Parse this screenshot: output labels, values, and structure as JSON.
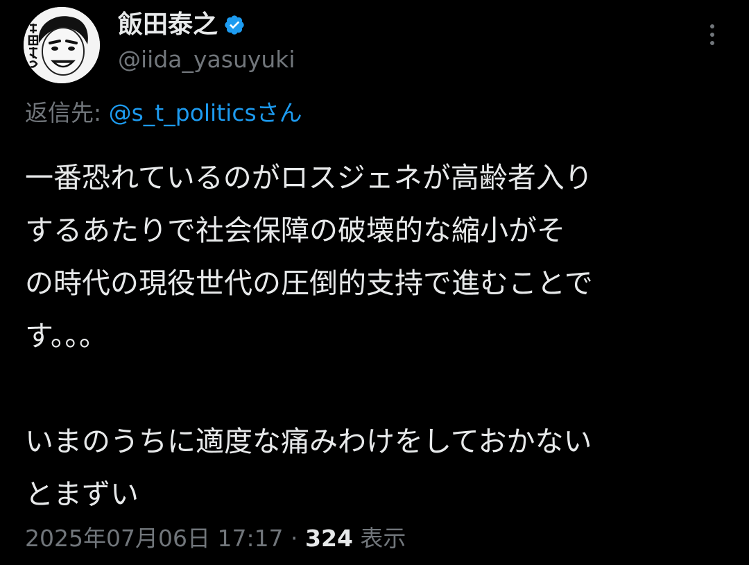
{
  "author": {
    "display_name": "飯田泰之",
    "handle": "@iida_yasuyuki",
    "verified": true,
    "avatar_icon": "avatar-illustration"
  },
  "menu": {
    "icon": "more-vertical-icon"
  },
  "reply": {
    "prefix": "返信先: ",
    "mention": "@s_t_politicsさん"
  },
  "body": {
    "lines": [
      "一番恐れているのがロスジェネが高齢者入り",
      "するあたりで社会保障の破壊的な縮小がそ",
      "の時代の現役世代の圧倒的支持で進むことで",
      "す。。。",
      "",
      "いまのうちに適度な痛みわけをしておかない",
      "とまずい"
    ]
  },
  "meta": {
    "timestamp": "2025年07月06日 17:17 · ",
    "views_count": "324",
    "views_label": " 表示"
  },
  "colors": {
    "background": "#000000",
    "text": "#e7e9ea",
    "secondary": "#71767b",
    "accent": "#1d9bf0"
  }
}
